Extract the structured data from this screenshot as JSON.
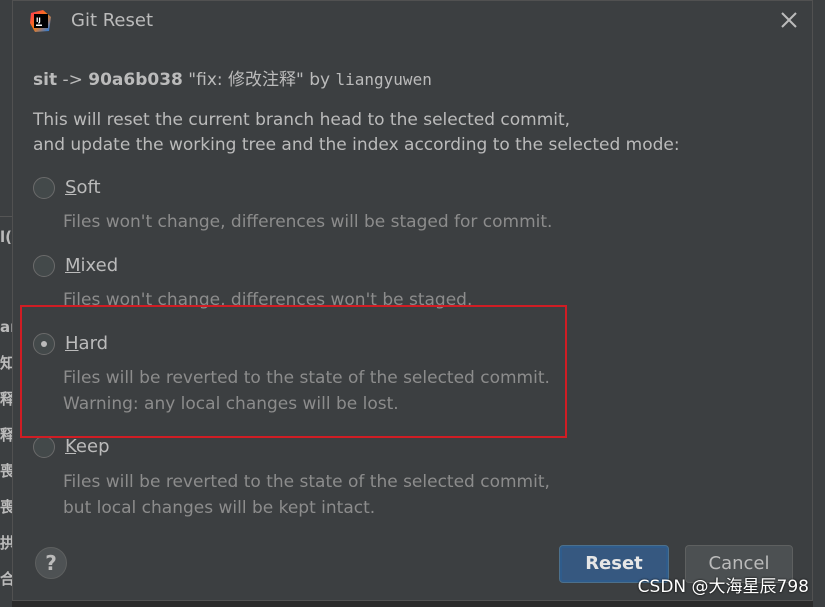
{
  "dialog": {
    "title": "Git Reset",
    "commit": {
      "branch": "sit",
      "arrow": " -> ",
      "hash": "90a6b038",
      "message": " \"fix: 修改注释\" by ",
      "author": "liangyuwen"
    },
    "description": {
      "line1": "This will reset the current branch head to the selected commit,",
      "line2": "and update the working tree and the index according to the selected mode:"
    },
    "options": [
      {
        "label": "Soft",
        "hint1": "Files won't change, differences will be staged for commit.",
        "selected": false
      },
      {
        "label": "Mixed",
        "hint1": "Files won't change, differences won't be staged.",
        "selected": false
      },
      {
        "label": "Hard",
        "hint1": "Files will be reverted to the state of the selected commit.",
        "hint2": "Warning: any local changes will be lost.",
        "selected": true
      },
      {
        "label": "Keep",
        "hint1": "Files will be reverted to the state of the selected commit,",
        "hint2": "but local changes will be kept intact.",
        "selected": false
      }
    ],
    "buttons": {
      "help": "?",
      "reset": "Reset",
      "cancel": "Cancel"
    }
  },
  "background": {
    "left_glyphs": [
      "l(",
      "an",
      "知",
      "释",
      "释",
      "喪",
      "喪",
      "拱",
      "合"
    ]
  },
  "watermark": "CSDN @大海星辰798",
  "colors": {
    "dialog_bg": "#3c3f41",
    "accent": "#365880",
    "highlight": "#d01d24"
  }
}
